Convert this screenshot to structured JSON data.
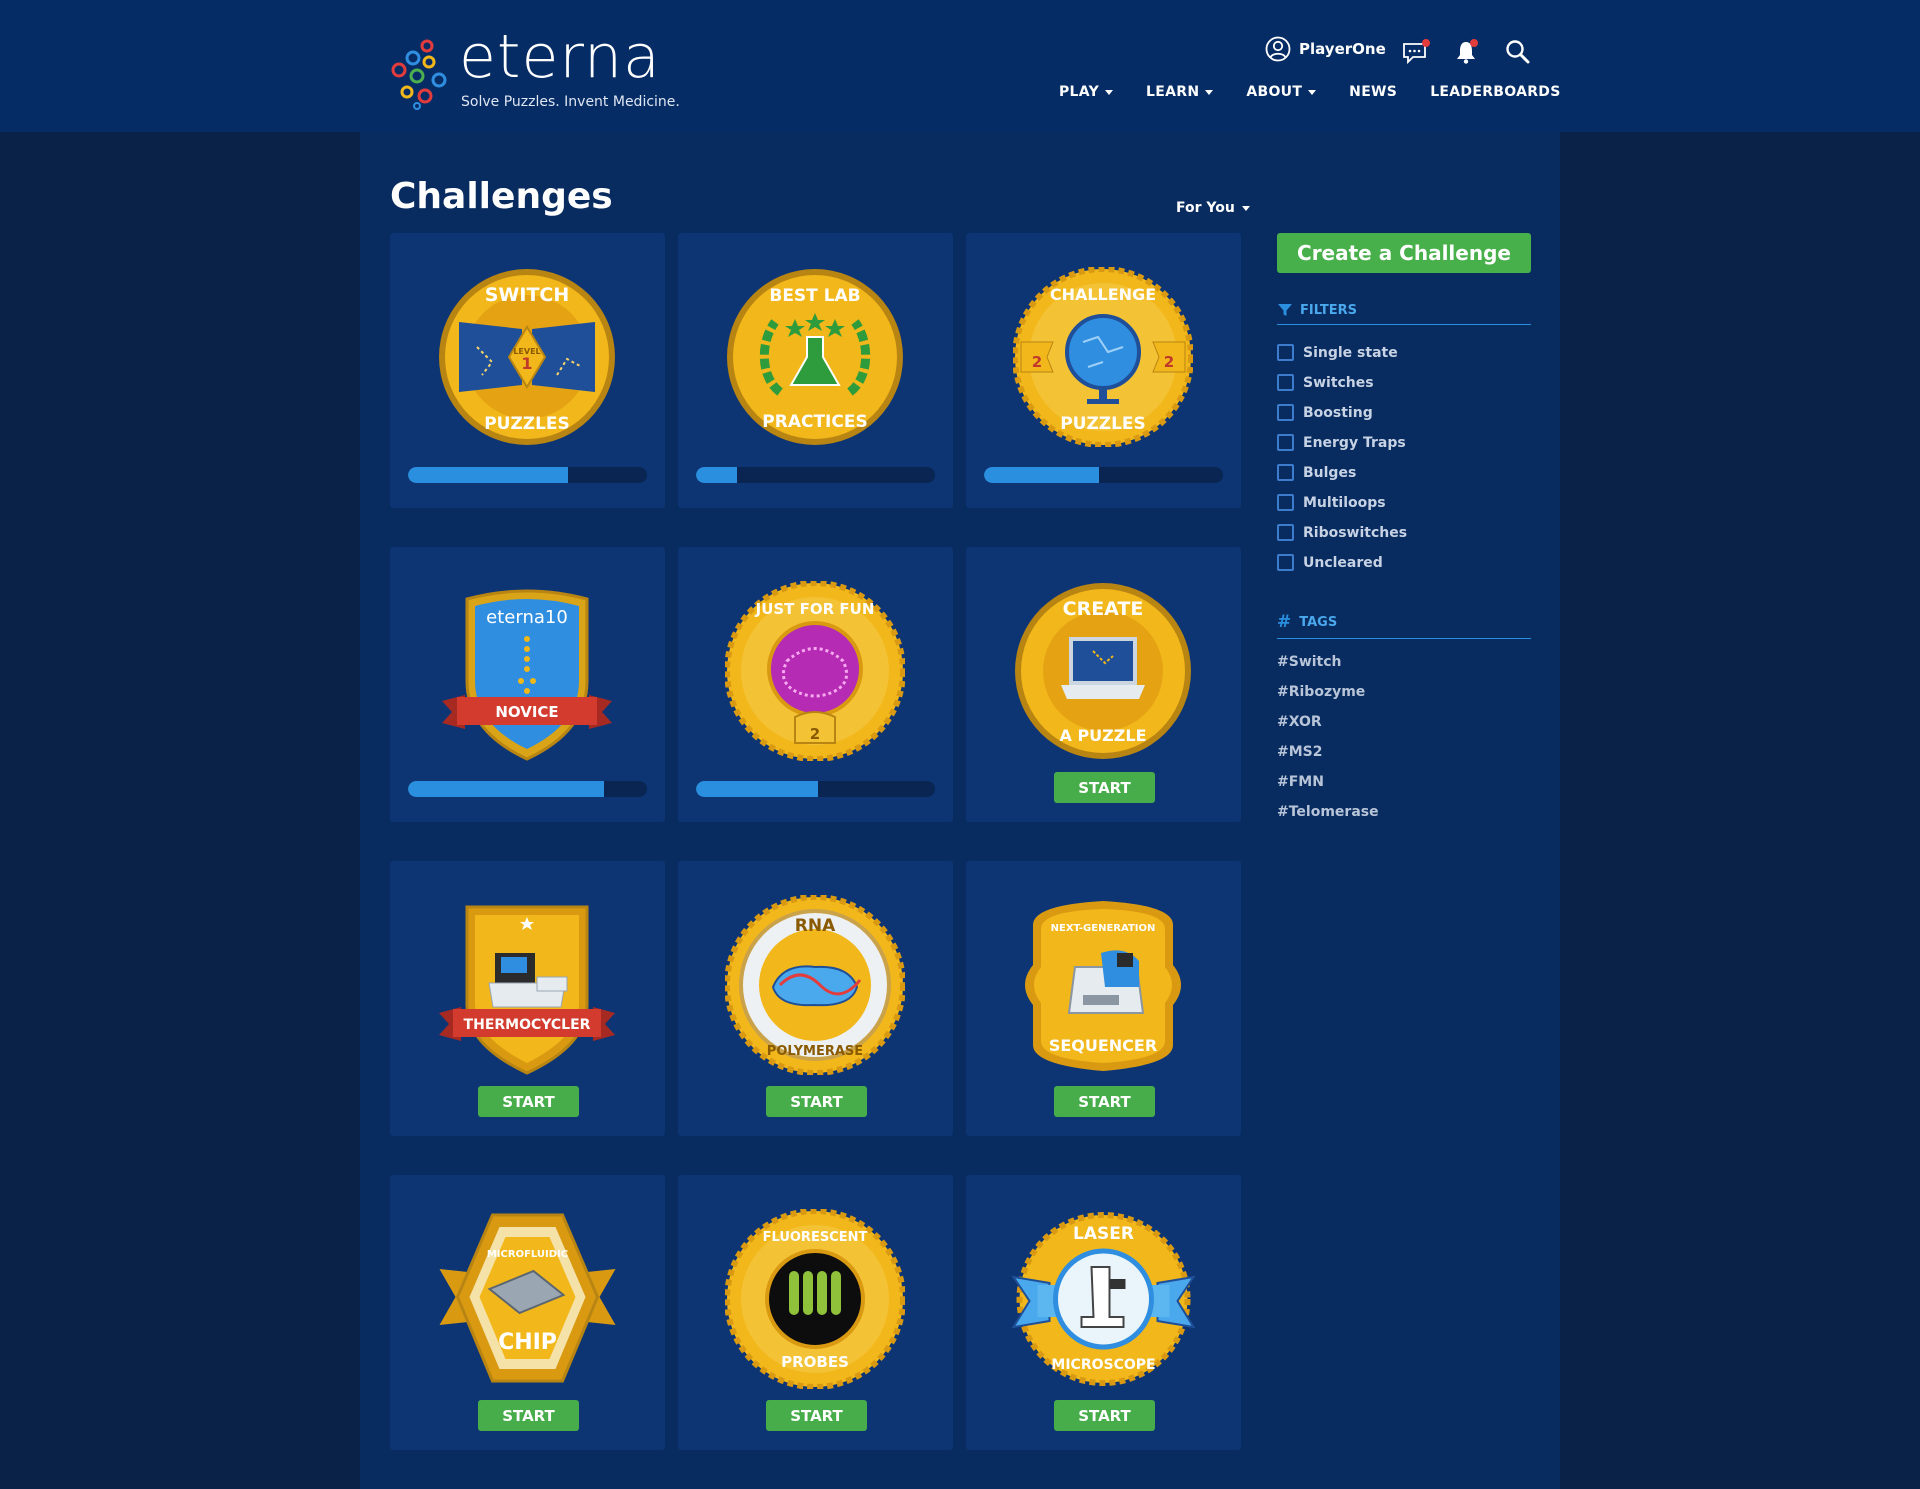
{
  "brand": {
    "name": "eterna",
    "tagline": "Solve Puzzles. Invent Medicine."
  },
  "header": {
    "username": "PlayerOne",
    "nav": [
      {
        "label": "PLAY",
        "dropdown": true
      },
      {
        "label": "LEARN",
        "dropdown": true
      },
      {
        "label": "ABOUT",
        "dropdown": true
      },
      {
        "label": "NEWS",
        "dropdown": false
      },
      {
        "label": "LEADERBOARDS",
        "dropdown": false
      }
    ]
  },
  "main": {
    "title": "Challenges",
    "sort_label": "For You"
  },
  "cards": [
    {
      "badge": "switch-puzzles-badge",
      "top_text": "SWITCH",
      "bottom_text": "PUZZLES",
      "level": "1",
      "progress": 0.67
    },
    {
      "badge": "best-lab-practices-badge",
      "top_text": "BEST LAB",
      "bottom_text": "PRACTICES",
      "progress": 0.17
    },
    {
      "badge": "challenge-puzzles-badge",
      "top_text": "CHALLENGE",
      "bottom_text": "PUZZLES",
      "level": "2",
      "progress": 0.48
    },
    {
      "badge": "eterna10-novice-badge",
      "top_text": "eterna10",
      "bottom_text": "NOVICE",
      "progress": 0.82
    },
    {
      "badge": "just-for-fun-badge",
      "top_text": "JUST FOR FUN",
      "level": "2",
      "progress": 0.51
    },
    {
      "badge": "create-a-puzzle-badge",
      "top_text": "CREATE",
      "bottom_text": "A PUZZLE",
      "action": "START"
    },
    {
      "badge": "thermocycler-badge",
      "bottom_text": "THERMOCYCLER",
      "action": "START"
    },
    {
      "badge": "rna-polymerase-badge",
      "top_text": "RNA",
      "bottom_text": "POLYMERASE",
      "action": "START"
    },
    {
      "badge": "next-generation-sequencer-badge",
      "top_text": "NEXT-GENERATION",
      "bottom_text": "SEQUENCER",
      "action": "START"
    },
    {
      "badge": "microfluidic-chip-badge",
      "top_text": "MICROFLUIDIC",
      "bottom_text": "CHIP",
      "action": "START"
    },
    {
      "badge": "fluorescent-probes-badge",
      "top_text": "FLUORESCENT",
      "bottom_text": "PROBES",
      "action": "START"
    },
    {
      "badge": "laser-microscope-badge",
      "top_text": "LASER",
      "bottom_text": "MICROSCOPE",
      "action": "START"
    }
  ],
  "sidebar": {
    "create_label": "Create a Challenge",
    "filters_heading": "FILTERS",
    "filters": [
      "Single state",
      "Switches",
      "Boosting",
      "Energy Traps",
      "Bulges",
      "Multiloops",
      "Riboswitches",
      "Uncleared"
    ],
    "tags_heading": "TAGS",
    "tags": [
      "#Switch",
      "#Ribozyme",
      "#XOR",
      "#MS2",
      "#FMN",
      "#Telomerase"
    ]
  },
  "colors": {
    "page_bg": "#0a2148",
    "header_bg": "#062c65",
    "card_bg": "#0d3573",
    "accent_blue": "#2a8fde",
    "start_green": "#46ad4a",
    "gold": "#f2b71a"
  }
}
